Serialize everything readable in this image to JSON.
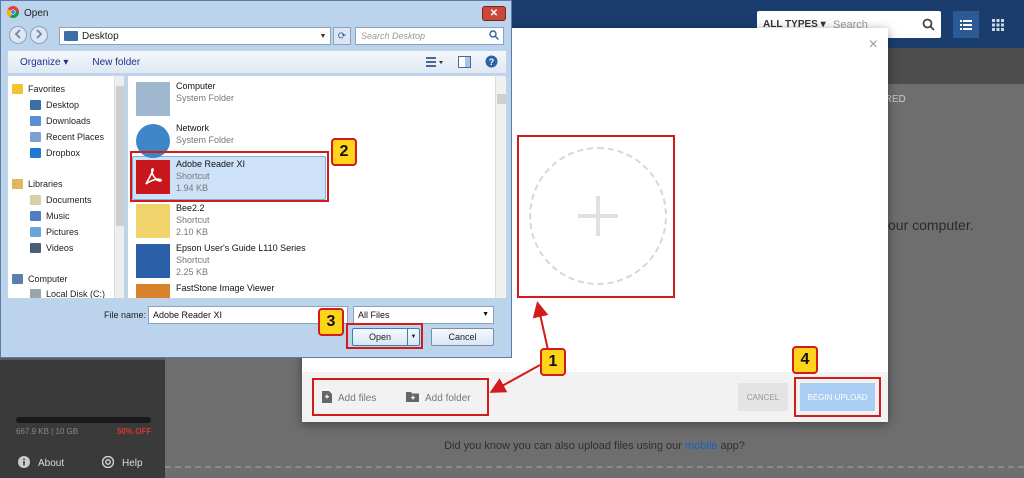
{
  "header": {
    "types_filter": "ALL TYPES ▾",
    "search_placeholder": "Search"
  },
  "sidebar": {
    "storage_text": "667.9 KB | 10 GB",
    "discount_text": "50% OFF",
    "about_label": "About",
    "help_label": "Help"
  },
  "background": {
    "shared_label": "ARED",
    "partial_text": "our computer.",
    "tip_prefix": "Did you know you can also upload files using our ",
    "tip_link": "mobile",
    "tip_suffix": " app?"
  },
  "modal": {
    "close_symbol": "×",
    "add_files_label": "Add files",
    "add_folder_label": "Add folder",
    "cancel_label": "CANCEL",
    "begin_upload_label": "BEGIN UPLOAD"
  },
  "callouts": [
    "1",
    "2",
    "3",
    "4"
  ],
  "dialog": {
    "title": "Open",
    "close_symbol": "✕",
    "address": "Desktop",
    "search_placeholder": "Search Desktop",
    "toolbar": {
      "organize": "Organize ▾",
      "new_folder": "New folder"
    },
    "nav": {
      "favorites": "Favorites",
      "favorites_items": [
        "Desktop",
        "Downloads",
        "Recent Places",
        "Dropbox"
      ],
      "libraries": "Libraries",
      "library_items": [
        "Documents",
        "Music",
        "Pictures",
        "Videos"
      ],
      "computer": "Computer",
      "computer_items": [
        "Local Disk (C:)"
      ]
    },
    "files": [
      {
        "name": "Computer",
        "sub1": "System Folder",
        "sub2": ""
      },
      {
        "name": "Network",
        "sub1": "System Folder",
        "sub2": ""
      },
      {
        "name": "Adobe Reader XI",
        "sub1": "Shortcut",
        "sub2": "1.94 KB"
      },
      {
        "name": "Bee2.2",
        "sub1": "Shortcut",
        "sub2": "2.10 KB"
      },
      {
        "name": "Epson User's Guide L110 Series",
        "sub1": "Shortcut",
        "sub2": "2.25 KB"
      },
      {
        "name": "FastStone Image Viewer",
        "sub1": "",
        "sub2": ""
      }
    ],
    "file_name_label": "File name:",
    "file_name_value": "Adobe Reader XI",
    "file_type_value": "All Files",
    "open_label": "Open",
    "cancel_label": "Cancel"
  },
  "colors": {
    "accent_red": "#d21b1b",
    "callout_yellow": "#ffd31a",
    "topbar_blue": "#1b3d6e",
    "upload_blue": "#a9cdf3"
  }
}
